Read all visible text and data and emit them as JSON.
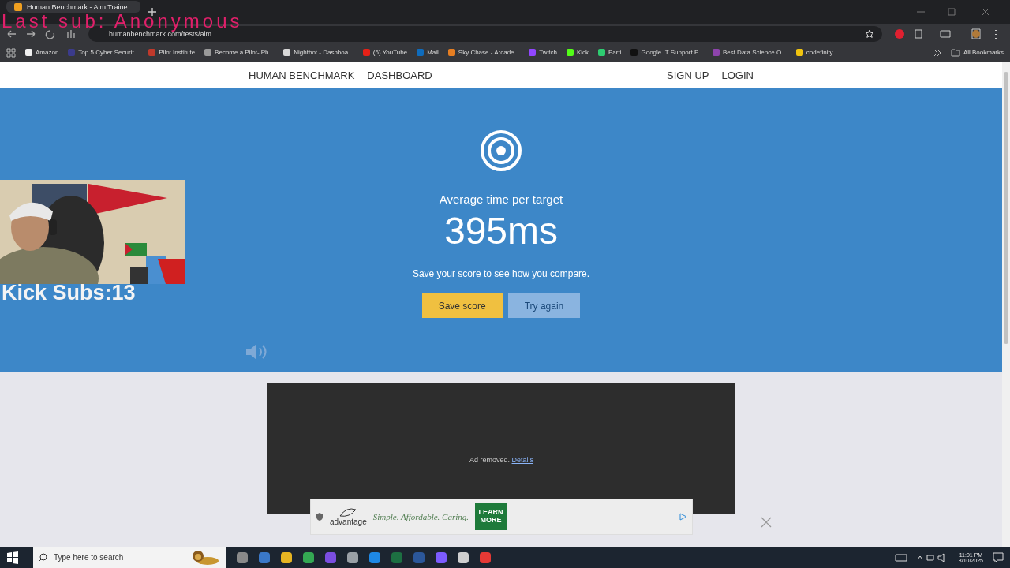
{
  "browser": {
    "tab": {
      "title": "Human Benchmark - Aim Traine",
      "selected": true
    },
    "url": "humanbenchmark.com/tests/aim",
    "bookmarks": [
      {
        "label": "Amazon",
        "color": "#f0f0f0"
      },
      {
        "label": "Top 5 Cyber Securit...",
        "color": "#3b3b8c"
      },
      {
        "label": "Pilot Institute",
        "color": "#c0392b"
      },
      {
        "label": "Become a Pilot- Ph...",
        "color": "#9a9a9a"
      },
      {
        "label": "Nightbot - Dashboa...",
        "color": "#d8d8d8"
      },
      {
        "label": "(6) YouTube",
        "color": "#e62117"
      },
      {
        "label": "Mail",
        "color": "#0f6cbd"
      },
      {
        "label": "Sky Chase - Arcade...",
        "color": "#e67e22"
      },
      {
        "label": "Twitch",
        "color": "#9146ff"
      },
      {
        "label": "Kick",
        "color": "#53fc18"
      },
      {
        "label": "Parti",
        "color": "#2ecc71"
      },
      {
        "label": "Google IT Support P...",
        "color": "#111111"
      },
      {
        "label": "Best Data Science O...",
        "color": "#8e44ad"
      },
      {
        "label": "codefinity",
        "color": "#f1c40f"
      }
    ],
    "all_bookmarks": "All Bookmarks"
  },
  "nav": {
    "brand": "HUMAN BENCHMARK",
    "links": [
      "DASHBOARD"
    ],
    "account": [
      "SIGN UP",
      "LOGIN"
    ]
  },
  "result": {
    "label": "Average time per target",
    "value": "395ms",
    "hint": "Save your score to see how you compare.",
    "buttons": [
      {
        "label": "Save score",
        "kind": "primary"
      },
      {
        "label": "Try again",
        "kind": "secondary"
      }
    ]
  },
  "ad": {
    "notice": "Ad removed.",
    "link": "Details"
  },
  "banner": {
    "brand": "advantage",
    "tagline": "Simple. Affordable. Caring.",
    "cta": "LEARN MORE"
  },
  "overlay": {
    "last_sub": "Last sub: Anonymous",
    "sub_count": "Kick Subs:13"
  },
  "taskbar": {
    "search_placeholder": "Type here to search",
    "time": "11:01 PM",
    "date": "8/10/2025"
  }
}
